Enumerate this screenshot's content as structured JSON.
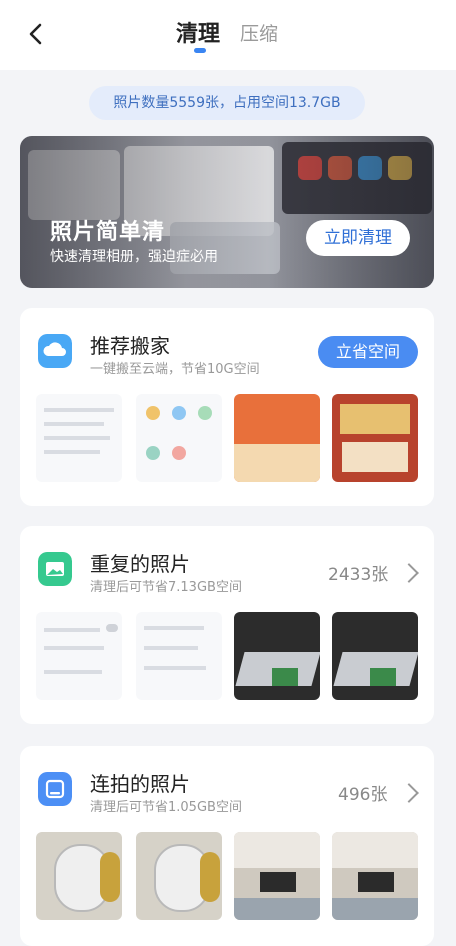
{
  "header": {
    "tabs": [
      {
        "label": "清理",
        "active": true
      },
      {
        "label": "压缩",
        "active": false
      }
    ],
    "accent": "#3a85f2"
  },
  "summary": {
    "text": "照片数量5559张，占用空间13.7GB"
  },
  "banner": {
    "title": "照片简单清",
    "subtitle": "快速清理相册，强迫症必用",
    "button_label": "立即清理"
  },
  "cards": [
    {
      "title": "推荐搬家",
      "subtitle": "一键搬至云端，节省10G空间",
      "button_label": "立省空间",
      "icon": "cloud-icon",
      "icon_color": "#49a8f5"
    },
    {
      "title": "重复的照片",
      "subtitle": "清理后可节省7.13GB空间",
      "count": "2433张",
      "icon": "image-icon",
      "icon_color": "#35c98f"
    },
    {
      "title": "连拍的照片",
      "subtitle": "清理后可节省1.05GB空间",
      "count": "496张",
      "icon": "burst-photo-icon",
      "icon_color": "#4c8ff5"
    }
  ]
}
